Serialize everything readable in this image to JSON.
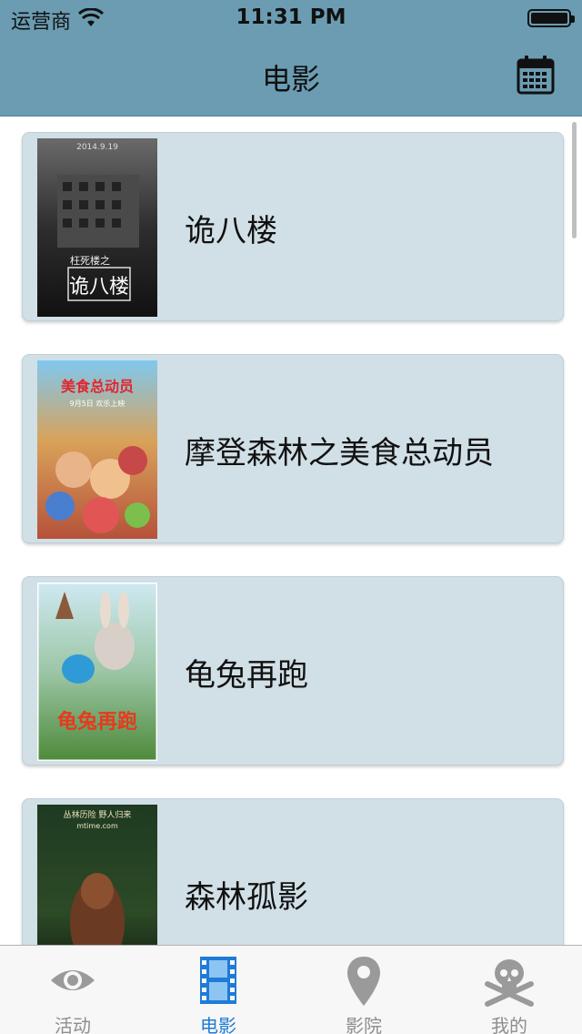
{
  "status_bar": {
    "carrier": "运营商",
    "time": "11:31 PM"
  },
  "nav": {
    "title": "电影",
    "right_icon": "calendar-icon"
  },
  "movies": [
    {
      "title": "诡八楼",
      "poster": {
        "date": "2014.9.19",
        "subtitle": "枉死楼之",
        "title_text": "诡八楼"
      }
    },
    {
      "title": "摩登森林之美食总动员",
      "poster": {
        "title_text": "美食总动员",
        "date": "9月5日 欢乐上映"
      }
    },
    {
      "title": "龟兔再跑",
      "poster": {
        "title_text": "龟兔再跑"
      }
    },
    {
      "title": "森林孤影",
      "poster": {
        "tagline": "丛林历险 野人归来",
        "site": "mtime.com"
      }
    }
  ],
  "tabs": [
    {
      "label": "活动",
      "icon": "eye-icon",
      "active": false
    },
    {
      "label": "电影",
      "icon": "film-icon",
      "active": true
    },
    {
      "label": "影院",
      "icon": "location-pin-icon",
      "active": false
    },
    {
      "label": "我的",
      "icon": "skull-crossbones-icon",
      "active": false
    }
  ],
  "colors": {
    "nav_bg": "#6b9cb2",
    "card_bg": "#d1dfe6",
    "tab_active": "#1f7bd6",
    "tab_inactive": "#8e8e8e"
  }
}
